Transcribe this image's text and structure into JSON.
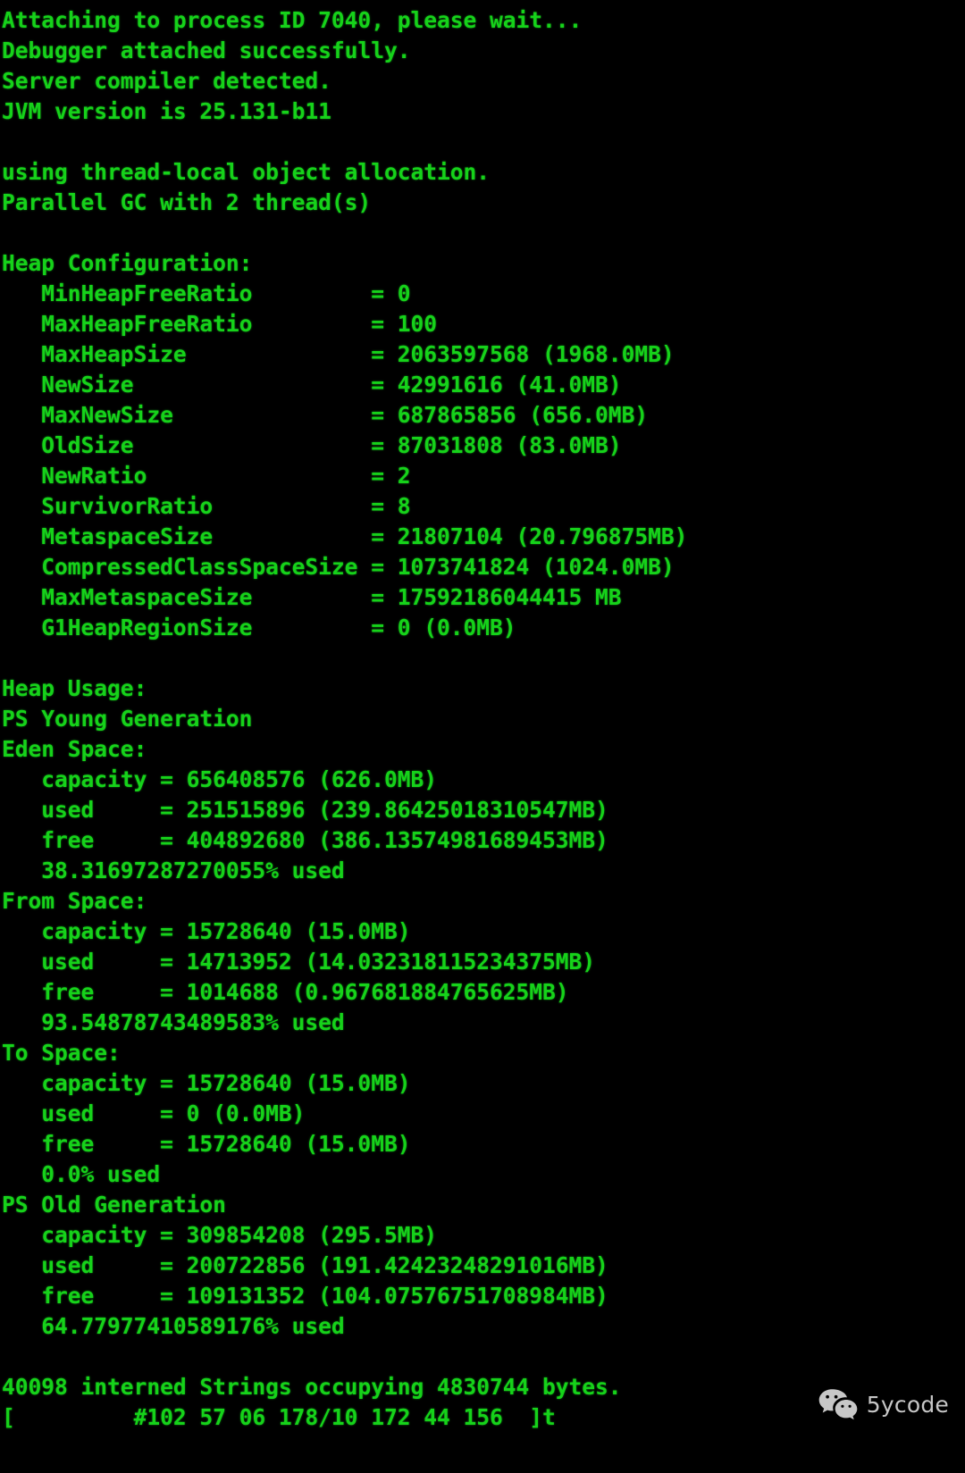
{
  "terminal": {
    "foreground_color": "#16d21a",
    "background_color": "#000000",
    "lines": [
      "Attaching to process ID 7040, please wait...",
      "Debugger attached successfully.",
      "Server compiler detected.",
      "JVM version is 25.131-b11",
      "",
      "using thread-local object allocation.",
      "Parallel GC with 2 thread(s)",
      "",
      "Heap Configuration:",
      "   MinHeapFreeRatio         = 0",
      "   MaxHeapFreeRatio         = 100",
      "   MaxHeapSize              = 2063597568 (1968.0MB)",
      "   NewSize                  = 42991616 (41.0MB)",
      "   MaxNewSize               = 687865856 (656.0MB)",
      "   OldSize                  = 87031808 (83.0MB)",
      "   NewRatio                 = 2",
      "   SurvivorRatio            = 8",
      "   MetaspaceSize            = 21807104 (20.796875MB)",
      "   CompressedClassSpaceSize = 1073741824 (1024.0MB)",
      "   MaxMetaspaceSize         = 17592186044415 MB",
      "   G1HeapRegionSize         = 0 (0.0MB)",
      "",
      "Heap Usage:",
      "PS Young Generation",
      "Eden Space:",
      "   capacity = 656408576 (626.0MB)",
      "   used     = 251515896 (239.86425018310547MB)",
      "   free     = 404892680 (386.13574981689453MB)",
      "   38.31697287270055% used",
      "From Space:",
      "   capacity = 15728640 (15.0MB)",
      "   used     = 14713952 (14.032318115234375MB)",
      "   free     = 1014688 (0.967681884765625MB)",
      "   93.54878743489583% used",
      "To Space:",
      "   capacity = 15728640 (15.0MB)",
      "   used     = 0 (0.0MB)",
      "   free     = 15728640 (15.0MB)",
      "   0.0% used",
      "PS Old Generation",
      "   capacity = 309854208 (295.5MB)",
      "   used     = 200722856 (191.42423248291016MB)",
      "   free     = 109131352 (104.07576751708984MB)",
      "   64.77977410589176% used",
      "",
      "40098 interned Strings occupying 4830744 bytes.",
      "[         #102 57 06 178/10 172 44 156  ]t"
    ]
  },
  "watermark": {
    "label": "5ycode",
    "icon": "wechat-icon",
    "color": "#d8d8d8"
  }
}
